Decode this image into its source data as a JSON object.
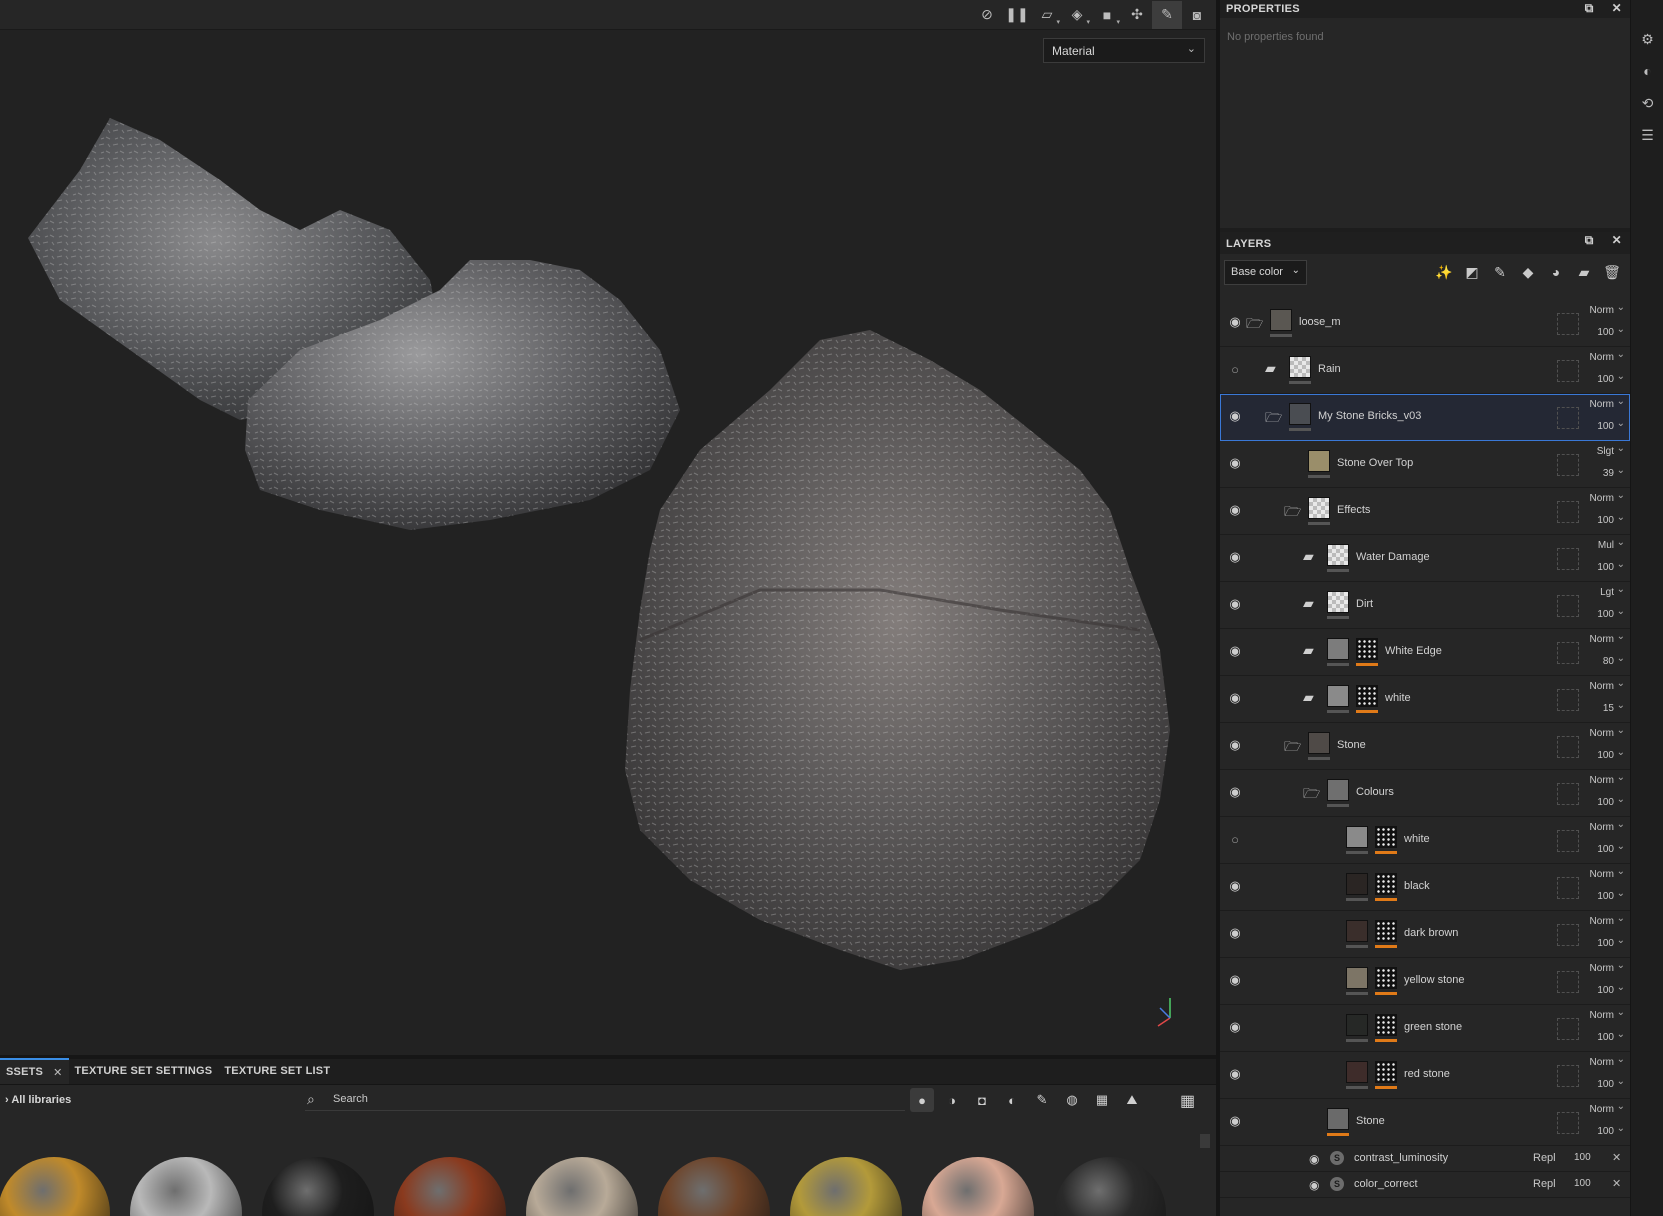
{
  "viewport": {
    "mode_select": "Material",
    "toolbar_icons": [
      "hide-icon",
      "pause-icon",
      "camera-projection-icon",
      "cube-view-icon",
      "camera-icon",
      "environment-icon",
      "paint-brush-icon",
      "screenshot-icon"
    ]
  },
  "properties": {
    "title": "PROPERTIES",
    "empty_text": "No properties found"
  },
  "layers": {
    "title": "LAYERS",
    "channel": "Base color",
    "items": [
      {
        "name": "loose_m",
        "blend": "Norm",
        "opacity": "100",
        "visible": true,
        "indent": 0,
        "folder": "open",
        "thumb": "#5a5752"
      },
      {
        "name": "Rain",
        "blend": "Norm",
        "opacity": "100",
        "visible": false,
        "indent": 1,
        "folder": "closed",
        "thumb": "checker"
      },
      {
        "name": "My Stone Bricks_v03",
        "blend": "Norm",
        "opacity": "100",
        "visible": true,
        "indent": 1,
        "folder": "open",
        "thumb": "#4a4d52",
        "selected": true
      },
      {
        "name": "Stone Over Top",
        "blend": "Slgt",
        "opacity": "39",
        "visible": true,
        "indent": 2,
        "folder": "none",
        "thumb": "#9a8e6a"
      },
      {
        "name": "Effects",
        "blend": "Norm",
        "opacity": "100",
        "visible": true,
        "indent": 2,
        "folder": "open",
        "thumb": "checker"
      },
      {
        "name": "Water Damage",
        "blend": "Mul",
        "opacity": "100",
        "visible": true,
        "indent": 3,
        "folder": "closed",
        "thumb": "checker"
      },
      {
        "name": "Dirt",
        "blend": "Lgt",
        "opacity": "100",
        "visible": true,
        "indent": 3,
        "folder": "closed",
        "thumb": "checker"
      },
      {
        "name": "White Edge",
        "blend": "Norm",
        "opacity": "80",
        "visible": true,
        "indent": 3,
        "folder": "closed",
        "thumb": "#7c7c7c",
        "mask": true
      },
      {
        "name": "white",
        "blend": "Norm",
        "opacity": "15",
        "visible": true,
        "indent": 3,
        "folder": "closed",
        "thumb": "#8a8a8a",
        "mask": true
      },
      {
        "name": "Stone",
        "blend": "Norm",
        "opacity": "100",
        "visible": true,
        "indent": 2,
        "folder": "open",
        "thumb": "#4f4a47"
      },
      {
        "name": "Colours",
        "blend": "Norm",
        "opacity": "100",
        "visible": true,
        "indent": 3,
        "folder": "open",
        "thumb": "#6f6f6f"
      },
      {
        "name": "white",
        "blend": "Norm",
        "opacity": "100",
        "visible": false,
        "indent": 4,
        "folder": "none",
        "thumb": "#8a8a8a",
        "mask": true
      },
      {
        "name": "black",
        "blend": "Norm",
        "opacity": "100",
        "visible": true,
        "indent": 4,
        "folder": "none",
        "thumb": "#2a2523",
        "mask": true
      },
      {
        "name": "dark brown",
        "blend": "Norm",
        "opacity": "100",
        "visible": true,
        "indent": 4,
        "folder": "none",
        "thumb": "#3a2e2b",
        "mask": true
      },
      {
        "name": "yellow stone",
        "blend": "Norm",
        "opacity": "100",
        "visible": true,
        "indent": 4,
        "folder": "none",
        "thumb": "#7d7566",
        "mask": true
      },
      {
        "name": "green stone",
        "blend": "Norm",
        "opacity": "100",
        "visible": true,
        "indent": 4,
        "folder": "none",
        "thumb": "#262826",
        "mask": true
      },
      {
        "name": "red stone",
        "blend": "Norm",
        "opacity": "100",
        "visible": true,
        "indent": 4,
        "folder": "none",
        "thumb": "#3e2c2a",
        "mask": true
      },
      {
        "name": "Stone",
        "blend": "Norm",
        "opacity": "100",
        "visible": true,
        "indent": 3,
        "folder": "none",
        "thumb": "#6a6a6a",
        "orange": true
      }
    ],
    "filters": [
      {
        "name": "contrast_luminosity",
        "blend": "Repl",
        "opacity": "100"
      },
      {
        "name": "color_correct",
        "blend": "Repl",
        "opacity": "100"
      }
    ]
  },
  "assets": {
    "tabs": [
      "SSETS",
      "TEXTURE SET SETTINGS",
      "TEXTURE SET LIST"
    ],
    "libraries": "All libraries",
    "search_placeholder": "Search",
    "spheres": [
      "#c08a2a",
      "#b9b9b9",
      "#1e1e1e",
      "#8a3a1e",
      "#b8aa98",
      "#6e4328",
      "#b39a3a",
      "#d8a894",
      "#2a2a2a"
    ]
  },
  "colors": {
    "accent": "#3a78d6",
    "mask_bar": "#e07a18",
    "panel": "#262626"
  }
}
